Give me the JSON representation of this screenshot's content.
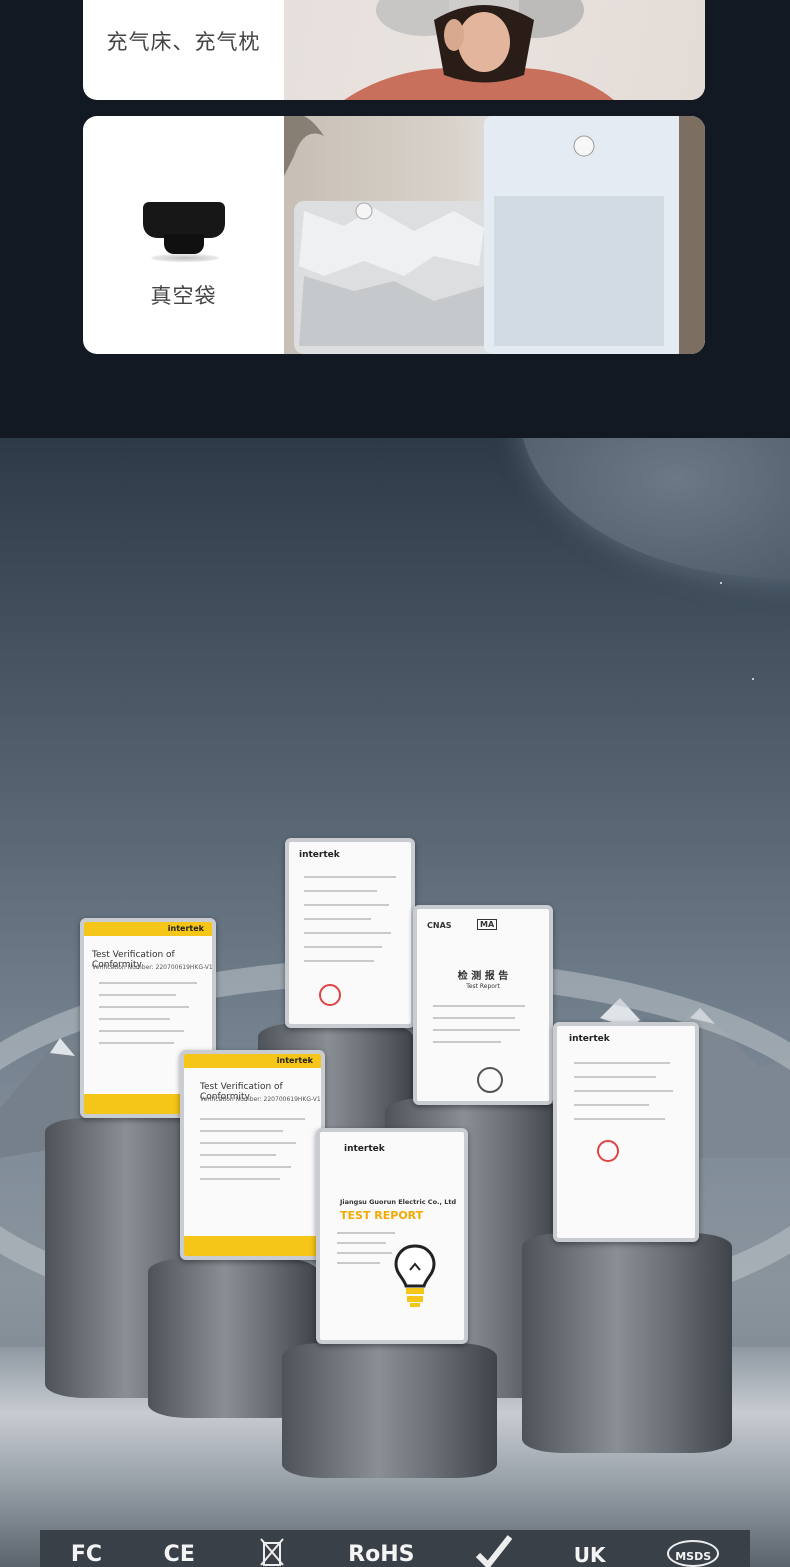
{
  "product_cards": [
    {
      "label": "充气床、充气枕"
    },
    {
      "label": "真空袋"
    }
  ],
  "certificates": [
    {
      "logo": "intertek",
      "title": "Test Verification of Conformity",
      "verification": "Verification Number: 220700619HKG-V1"
    },
    {
      "logo": "intertek",
      "title": "Test Verification of Conformity",
      "verification": "Verification Number: 220700619HKG-V1"
    },
    {
      "logo": "intertek"
    },
    {
      "heading": "检 测 报 告",
      "subheading": "Test Report",
      "marks": [
        "CNAS",
        "MA"
      ]
    },
    {
      "logo": "intertek",
      "company": "Jiangsu Guorun Electric Co., Ltd",
      "title": "TEST REPORT"
    },
    {
      "logo": "intertek"
    }
  ],
  "compliance_marks": [
    "FC",
    "CE",
    "RoHS",
    "UK",
    "MSDS"
  ],
  "colors": {
    "dark_background": "#131a24",
    "card_background": "#ffffff",
    "certificate_yellow": "#f5c518",
    "report_orange": "#f2a900"
  }
}
